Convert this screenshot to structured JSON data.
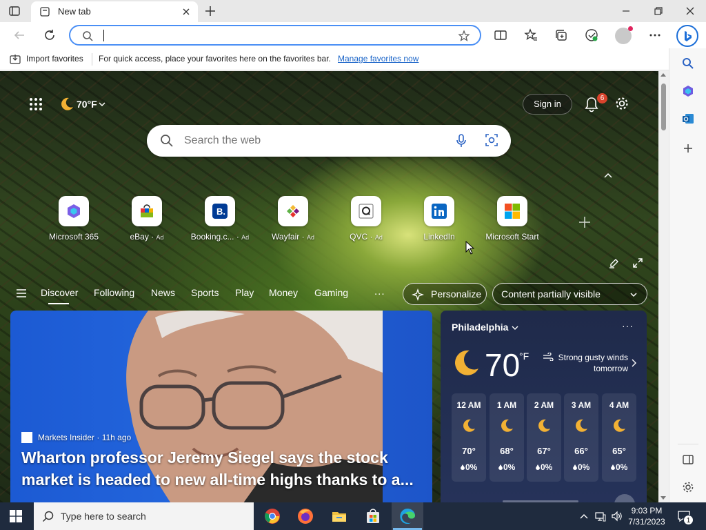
{
  "browser": {
    "tab": {
      "title": "New tab"
    },
    "address_bar": {
      "value": "",
      "placeholder": ""
    },
    "favorites_bar": {
      "import_label": "Import favorites",
      "hint": "For quick access, place your favorites here on the favorites bar.",
      "manage_link": "Manage favorites now"
    }
  },
  "newtab": {
    "weather_temp": "70°F",
    "sign_in": "Sign in",
    "notification_count": "6",
    "search_placeholder": "Search the web",
    "quick_links": [
      {
        "label": "Microsoft 365",
        "ad": ""
      },
      {
        "label": "eBay",
        "ad": "Ad"
      },
      {
        "label": "Booking.c...",
        "ad": "Ad"
      },
      {
        "label": "Wayfair",
        "ad": "Ad"
      },
      {
        "label": "QVC",
        "ad": "Ad"
      },
      {
        "label": "LinkedIn",
        "ad": ""
      },
      {
        "label": "Microsoft Start",
        "ad": ""
      }
    ],
    "feed_nav": [
      "Discover",
      "Following",
      "News",
      "Sports",
      "Play",
      "Money",
      "Gaming"
    ],
    "more": "...",
    "personalize": "Personalize",
    "content_visibility": "Content partially visible"
  },
  "hero": {
    "source": "Markets Insider · 11h ago",
    "headline": "Wharton professor Jeremy Siegel says the stock market is headed to new all-time highs thanks to a..."
  },
  "weather_card": {
    "city": "Philadelphia",
    "temp": "70",
    "unit": "°F",
    "forecast_note": "Strong gusty winds tomorrow",
    "hourly": [
      {
        "time": "12 AM",
        "temp": "70°",
        "precip": "0%"
      },
      {
        "time": "1 AM",
        "temp": "68°",
        "precip": "0%"
      },
      {
        "time": "2 AM",
        "temp": "67°",
        "precip": "0%"
      },
      {
        "time": "3 AM",
        "temp": "66°",
        "precip": "0%"
      },
      {
        "time": "4 AM",
        "temp": "65°",
        "precip": "0%"
      }
    ]
  },
  "taskbar": {
    "search_placeholder": "Type here to search",
    "time": "9:03 PM",
    "date": "7/31/2023",
    "notification_count": "1"
  },
  "colors": {
    "accent": "#1b6ed8",
    "link": "#1a64c8",
    "taskbar": "#1f2b3e",
    "weather_card": "#1f2a4a",
    "hero_bg": "#1c5ad3"
  }
}
